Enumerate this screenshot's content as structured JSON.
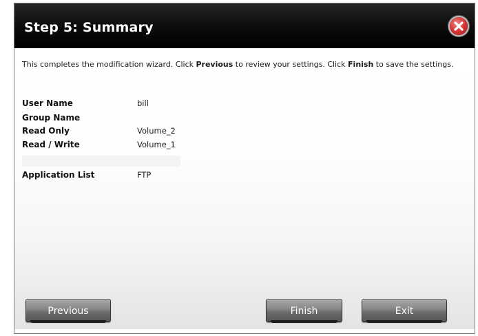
{
  "dialog": {
    "title": "Step 5: Summary"
  },
  "content": {
    "intro_part1": "This completes the modification wizard. Click ",
    "intro_previous": "Previous",
    "intro_part2": " to review your settings. Click ",
    "intro_finish": "Finish",
    "intro_part3": " to save the settings."
  },
  "summary": [
    {
      "label": "User Name",
      "value": "bill"
    },
    {
      "label": "Group Name",
      "value": ""
    },
    {
      "label": "Read Only",
      "value": "Volume_2"
    },
    {
      "label": "Read / Write",
      "value": "Volume_1"
    },
    {
      "label": "Application List",
      "value": "FTP"
    }
  ],
  "buttons": {
    "previous": "Previous",
    "finish": "Finish",
    "exit": "Exit"
  },
  "colors": {
    "titlebar": "#000000",
    "title_text": "#ffffff",
    "close_red": "#d83b3b",
    "button_gray": "#7a7a7a"
  },
  "icons": {
    "close": "close-icon"
  }
}
